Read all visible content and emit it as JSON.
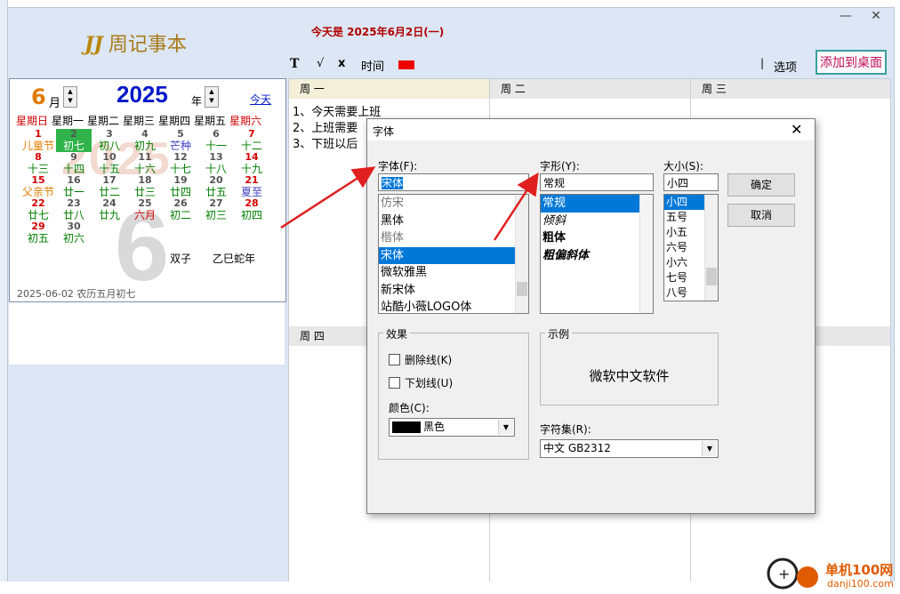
{
  "app": {
    "logo_mark": "JJ",
    "logo_name": "周记事本",
    "today_text": "今天是 2025年6月2日(一)",
    "min_label": "—",
    "close_label": "✕"
  },
  "calendar": {
    "month": "6",
    "month_label": "月",
    "year": "2025",
    "year_label": "年",
    "today_link": "今天",
    "weekdays": [
      "星期日",
      "星期一",
      "星期二",
      "星期三",
      "星期四",
      "星期五",
      "星期六"
    ],
    "days": [
      {
        "n": "1",
        "l": "儿童节"
      },
      {
        "n": "2",
        "l": "初七"
      },
      {
        "n": "3",
        "l": "初八"
      },
      {
        "n": "4",
        "l": "初九"
      },
      {
        "n": "5",
        "l": "芒种"
      },
      {
        "n": "6",
        "l": "十一"
      },
      {
        "n": "7",
        "l": "十二"
      },
      {
        "n": "8",
        "l": "十三"
      },
      {
        "n": "9",
        "l": "十四"
      },
      {
        "n": "10",
        "l": "十五"
      },
      {
        "n": "11",
        "l": "十六"
      },
      {
        "n": "12",
        "l": "十七"
      },
      {
        "n": "13",
        "l": "十八"
      },
      {
        "n": "14",
        "l": "十九"
      },
      {
        "n": "15",
        "l": "父亲节"
      },
      {
        "n": "16",
        "l": "廿一"
      },
      {
        "n": "17",
        "l": "廿二"
      },
      {
        "n": "18",
        "l": "廿三"
      },
      {
        "n": "19",
        "l": "廿四"
      },
      {
        "n": "20",
        "l": "廿五"
      },
      {
        "n": "21",
        "l": "夏至"
      },
      {
        "n": "22",
        "l": "廿七"
      },
      {
        "n": "23",
        "l": "廿八"
      },
      {
        "n": "24",
        "l": "廿九"
      },
      {
        "n": "25",
        "l": "六月"
      },
      {
        "n": "26",
        "l": "初二"
      },
      {
        "n": "27",
        "l": "初三"
      },
      {
        "n": "28",
        "l": "初四"
      },
      {
        "n": "29",
        "l": "初五"
      },
      {
        "n": "30",
        "l": "初六"
      }
    ],
    "big_day": "6",
    "bg_year": "2025",
    "zodiac": "双子",
    "ganzhi": "乙巳蛇年",
    "footer": "2025-06-02 农历五月初七",
    "colors": {
      "sunday": "#d40000",
      "saturday": "#d40000",
      "lunar": "#008000",
      "festival": "#e07b00",
      "solar_term": "#4040c0",
      "selected": "#2fb34a"
    }
  },
  "toolbar": {
    "bold": "T",
    "check": "√",
    "delete": "x",
    "time": "时间",
    "sep": "|",
    "options": "选项",
    "add_desktop": "添加到桌面"
  },
  "week": {
    "headers": [
      "周 一",
      "周 二",
      "周 三",
      "周 四"
    ],
    "monday_notes": [
      "1、今天需要上班",
      "2、上班需要",
      "3、下班以后"
    ]
  },
  "font_dialog": {
    "title": "字体",
    "close": "✕",
    "font_label": "字体(F):",
    "font_value": "宋体",
    "font_list": [
      "仿宋",
      "黑体",
      "楷体",
      "宋体",
      "微软雅黑",
      "新宋体",
      "站酷小薇LOGO体"
    ],
    "font_selected": 3,
    "style_label": "字形(Y):",
    "style_value": "常规",
    "style_list": [
      "常规",
      "倾斜",
      "粗体",
      "粗偏斜体"
    ],
    "style_selected": 0,
    "size_label": "大小(S):",
    "size_value": "小四",
    "size_list": [
      "小四",
      "五号",
      "小五",
      "六号",
      "小六",
      "七号",
      "八号"
    ],
    "size_selected": 0,
    "ok": "确定",
    "cancel": "取消",
    "effects_label": "效果",
    "strikeout": "删除线(K)",
    "underline": "下划线(U)",
    "color_label": "颜色(C):",
    "color_value": "黑色",
    "sample_label": "示例",
    "sample_text": "微软中文软件",
    "charset_label": "字符集(R):",
    "charset_value": "中文 GB2312"
  },
  "watermark": {
    "text": "单机100网",
    "url": "danji100.com"
  }
}
